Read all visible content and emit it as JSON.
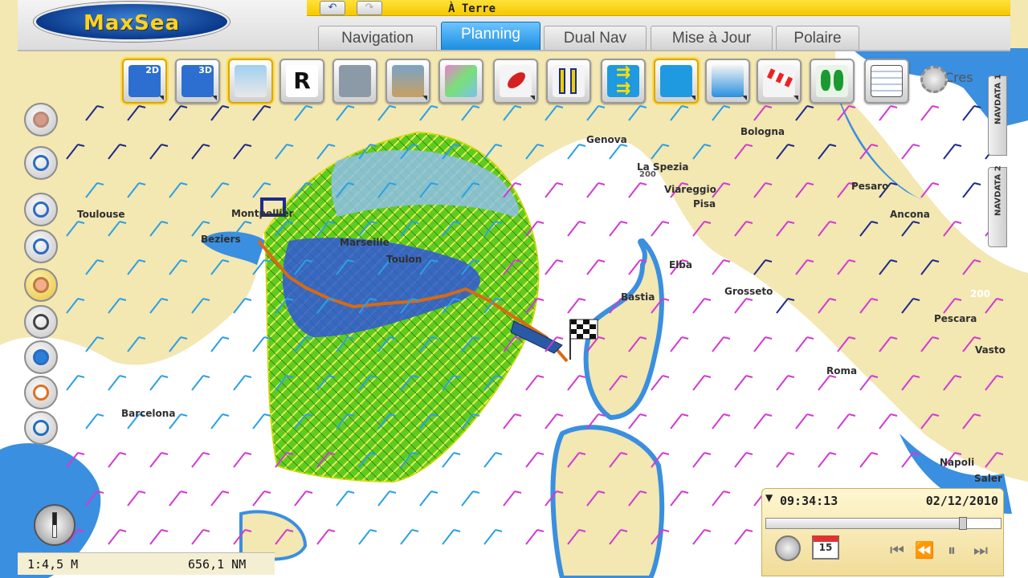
{
  "app": {
    "logo": "MaxSea",
    "title": "À Terre"
  },
  "tabs": [
    {
      "label": "Navigation",
      "active": false
    },
    {
      "label": "Planning",
      "active": true
    },
    {
      "label": "Dual Nav",
      "active": false
    },
    {
      "label": "Mise à Jour",
      "active": false
    },
    {
      "label": "Polaire",
      "active": false
    }
  ],
  "toolbar": {
    "icons": [
      "north-up-2d-icon",
      "north-up-3d-icon",
      "chart-overlay-icon",
      "route-r-icon",
      "vector-chart-icon",
      "satellite-photo-icon",
      "weather-colors-icon",
      "boat-marker-icon",
      "tide-gauge-icon",
      "current-arrows-icon",
      "wind-arrows-icon",
      "download-weather-icon",
      "windsock-icon",
      "routing-boats-icon",
      "table-icon",
      "settings-gears-icon"
    ],
    "icon_texts": {
      "2d": "2D",
      "3d": "3D",
      "r": "R"
    }
  },
  "left_tools": [
    "layers-icon",
    "zoom-icon",
    "zoom-in-icon",
    "zoom-out-icon",
    "pan-hand-icon",
    "measure-icon",
    "globe-icon",
    "lifebuoy-icon",
    "compass-tool-icon"
  ],
  "right_tabs": [
    "NAVDATA 1",
    "NAVDATA 2"
  ],
  "map": {
    "cities": [
      "Genova",
      "Bologna",
      "La Spezia",
      "Viareggio",
      "Pisa",
      "Pesaro",
      "Ancona",
      "Toulouse",
      "Montpellier",
      "Beziers",
      "Marseille",
      "Toulon",
      "Elba",
      "Grosseto",
      "Bastia",
      "Pescara",
      "Vasto",
      "Roma",
      "Barcelona",
      "Napoli",
      "Saler",
      "Cres"
    ],
    "depth_labels": [
      "200",
      "200"
    ],
    "colors": {
      "land": "#f3e7b2",
      "sea": "#ffffff",
      "shallow": "#3a8fe0",
      "routing_green": "#5dcc1e",
      "routing_yellow": "#e9f34a",
      "route": "#d86a12",
      "wind_light": "#2aa0e6",
      "wind_strong": "#d23ad2",
      "wind_dark": "#1e2a8a"
    }
  },
  "time_panel": {
    "time": "09:34:13",
    "date": "02/12/2010",
    "progress": 0.84,
    "calendar_day": "15"
  },
  "status": {
    "scale": "1:4,5 M",
    "distance": "656,1 NM"
  }
}
